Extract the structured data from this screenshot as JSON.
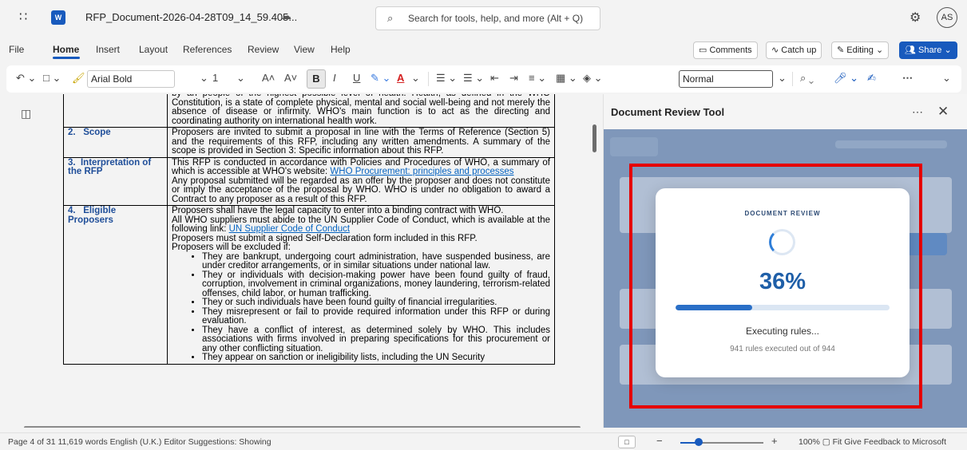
{
  "app": {
    "doc_title": "RFP_Document-2026-04-28T09_14_59.405...",
    "search_placeholder": "Search for tools, help, and more (Alt + Q)",
    "avatar_initials": "AS"
  },
  "menu": {
    "items": [
      "File",
      "Home",
      "Insert",
      "Layout",
      "References",
      "Review",
      "View",
      "Help"
    ],
    "active": "Home",
    "comments": "Comments",
    "catch_up": "Catch up",
    "editing": "Editing",
    "share": "Share"
  },
  "ribbon": {
    "font_name": "Arial Bold",
    "font_size": "1",
    "style_name": "Normal"
  },
  "document": {
    "row0_text": "by an people of the highest possible level of health. Health, as defined in the WHO Constitution, is a state of complete physical, mental and social well-being and not merely the absence of disease or infirmity. WHO's main function is to act as the directing and coordinating authority on international health work.",
    "row1_num": "2.",
    "row1_label": "Scope",
    "row1_text": "Proposers are invited to submit a proposal in line with the Terms of Reference (Section 5) and the requirements of this RFP, including any written amendments. A summary of the scope is provided in Section 3: Specific information about this RFP.",
    "row2_num": "3.",
    "row2_label": "Interpretation of the RFP",
    "row2_text_a": "This RFP is conducted in accordance with Policies and Procedures of WHO, a summary of which is accessible at WHO's website: ",
    "row2_link": "WHO Procurement: principles and processes",
    "row2_text_b": "Any proposal submitted will be regarded as an offer by the proposer and does not constitute or imply the acceptance of the proposal by WHO. WHO is under no obligation to award a Contract to any proposer as a result of this RFP.",
    "row3_num": "4.",
    "row3_label": "Eligible Proposers",
    "row3_p1": "Proposers shall have the legal capacity to enter into a binding contract with WHO.",
    "row3_p2a": "All WHO suppliers must abide to the UN Supplier Code of Conduct, which is available at the following link: ",
    "row3_p2_link": "UN Supplier Code of Conduct",
    "row3_p3": "Proposers must submit a signed Self-Declaration form included in this RFP.",
    "row3_p4": "Proposers will be excluded if:",
    "bullets": [
      "They are bankrupt, undergoing court administration, have suspended business, are under creditor arrangements, or in similar situations under national law.",
      "They or individuals with decision-making power have been found guilty of fraud, corruption, involvement in criminal organizations, money laundering, terrorism-related offenses, child labor, or human trafficking.",
      "They or such individuals have been found guilty of financial irregularities.",
      "They misrepresent or fail to provide required information under this RFP or during evaluation.",
      "They have a conflict of interest, as determined solely by WHO. This includes associations with firms involved in preparing specifications for this procurement or any other conflicting situation.",
      "They appear on sanction or ineligibility lists, including the UN Security"
    ]
  },
  "pane": {
    "title": "Document Review Tool",
    "eyebrow": "DOCUMENT REVIEW",
    "percent_text": "36%",
    "progress_fraction": 0.36,
    "status": "Executing rules...",
    "substatus": "941 rules executed out of 944"
  },
  "statusbar": {
    "left": "Page 4 of 31   11,619 words   English (U.K.)   Editor Suggestions: Showing",
    "right": "100%  ▢ Fit   Give Feedback to Microsoft"
  },
  "colors": {
    "accent": "#185abd",
    "highlight": "#e50000",
    "progress": "#2a6fc7"
  }
}
